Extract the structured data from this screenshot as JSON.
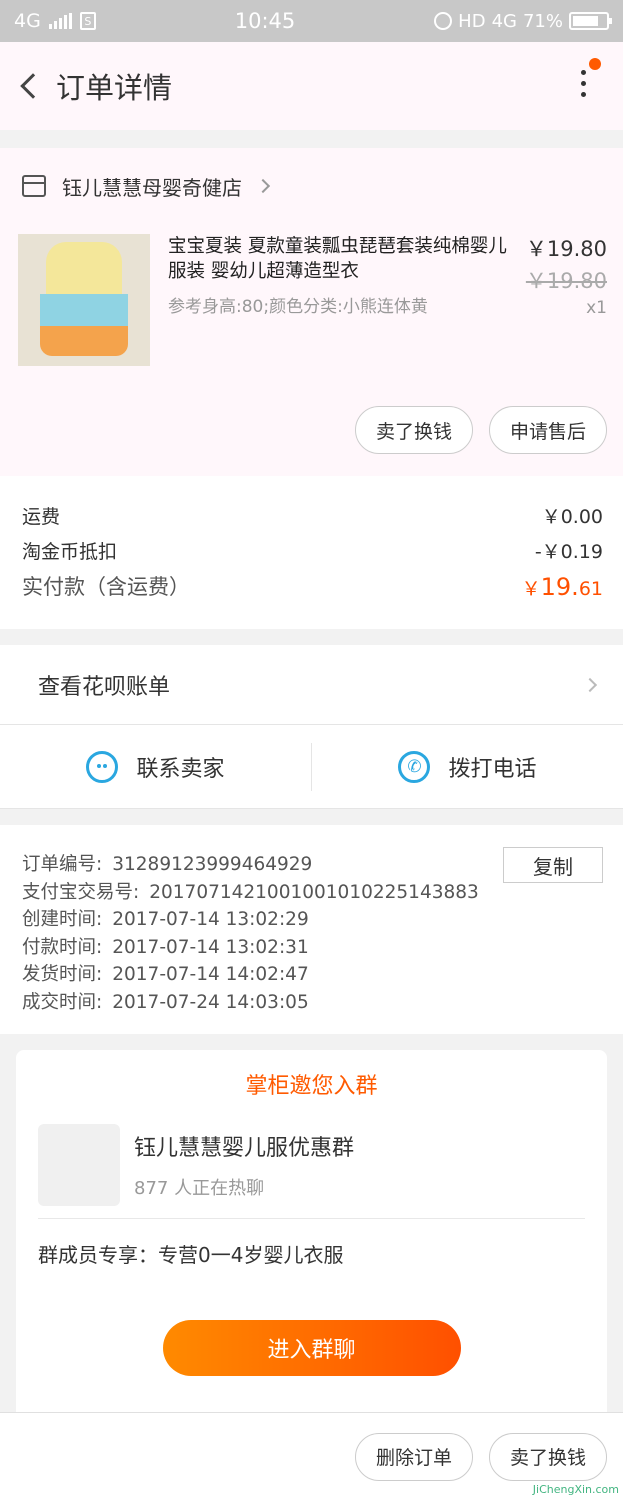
{
  "status_bar": {
    "network": "4G",
    "time": "10:45",
    "hd": "HD",
    "net2": "4G",
    "battery": "71%"
  },
  "navbar": {
    "title": "订单详情"
  },
  "shop": {
    "name": "钰儿慧慧母婴奇健店"
  },
  "product": {
    "title": "宝宝夏装 夏款童装瓢虫琵琶套装纯棉婴儿服装 婴幼儿超薄造型衣",
    "sku": "参考身高:80;颜色分类:小熊连体黄",
    "price": "￥19.80",
    "original_price": "￥19.80",
    "quantity": "x1"
  },
  "product_actions": {
    "exchange": "卖了换钱",
    "after_sale": "申请售后"
  },
  "costs": {
    "shipping_label": "运费",
    "shipping_value": "￥0.00",
    "coin_label": "淘金币抵扣",
    "coin_value": "-￥0.19",
    "total_label": "实付款（含运费）",
    "total_symbol": "￥",
    "total_int": "19.",
    "total_dec": "61"
  },
  "huabei": {
    "label": "查看花呗账单"
  },
  "contact": {
    "seller": "联系卖家",
    "call": "拨打电话"
  },
  "order_info": {
    "copy_label": "复制",
    "rows": [
      {
        "k": "订单编号:",
        "v": "31289123999464929"
      },
      {
        "k": "支付宝交易号:",
        "v": "2017071421001001010225143883"
      },
      {
        "k": "创建时间:",
        "v": "2017-07-14 13:02:29"
      },
      {
        "k": "付款时间:",
        "v": "2017-07-14 13:02:31"
      },
      {
        "k": "发货时间:",
        "v": "2017-07-14 14:02:47"
      },
      {
        "k": "成交时间:",
        "v": "2017-07-24 14:03:05"
      }
    ]
  },
  "group": {
    "title": "掌柜邀您入群",
    "name": "钰儿慧慧婴儿服优惠群",
    "count": "877 人正在热聊",
    "perk": "群成员专享：专营0一4岁婴儿衣服",
    "join": "进入群聊"
  },
  "bottom_bar": {
    "delete": "删除订单",
    "exchange": "卖了换钱"
  },
  "watermark": "JiChengXin.com",
  "colors": {
    "accent": "#ff5000",
    "blue": "#2aa7e0"
  }
}
